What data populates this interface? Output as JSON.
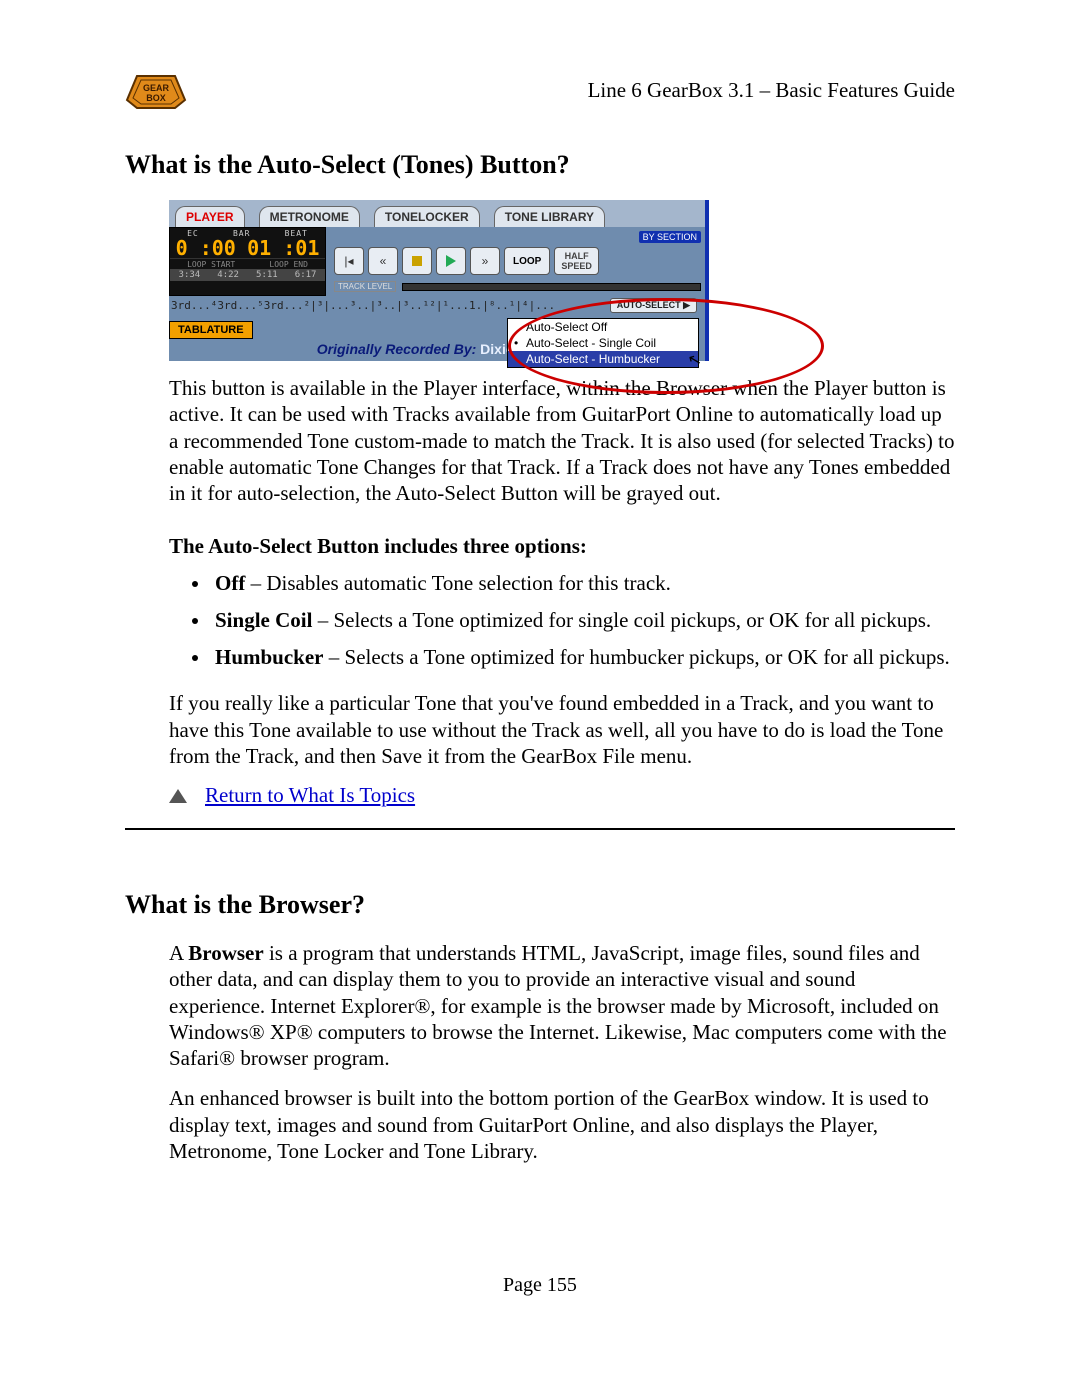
{
  "header": {
    "doc_title": "Line 6 GearBox 3.1 – Basic Features Guide"
  },
  "section1": {
    "heading": "What is the Auto-Select (Tones) Button?",
    "para1": "This button is available in the Player interface, within the Browser when the Player button is active. It can be used with Tracks available from GuitarPort Online to automatically load up a recommended Tone custom-made to match the Track. It is also used (for selected Tracks) to enable automatic Tone Changes for that Track. If a Track does not have any Tones embedded in it for auto-selection, the Auto-Select Button will be grayed out.",
    "subhead": "The Auto-Select Button includes three options:",
    "options": [
      {
        "bold": "Off",
        "text": " – Disables automatic Tone selection for this track."
      },
      {
        "bold": "Single Coil",
        "text": " – Selects a Tone optimized for single coil pickups, or OK for all pickups."
      },
      {
        "bold": "Humbucker",
        "text": " – Selects a Tone optimized for humbucker pickups, or OK for all pickups."
      }
    ],
    "para2": "If you really like a particular Tone that you've found embedded in a Track, and you want to have this Tone available to use without the Track as well, all you have to do is load the Tone from the Track, and then Save it from the GearBox File menu.",
    "return_label": "Return to What Is Topics"
  },
  "section2": {
    "heading": "What is the Browser?",
    "para1_pre": "A ",
    "para1_bold": "Browser",
    "para1_post": " is a program that understands HTML, JavaScript, image files, sound files and other data, and can display them to you to provide an interactive visual and sound experience. Internet Explorer®, for example is the browser made by Microsoft, included on Windows® XP® computers to browse the Internet. Likewise, Mac computers come with the Safari® browser program.",
    "para2": "An enhanced browser is built into the bottom portion of the GearBox window. It is used to display text, images and sound from GuitarPort Online, and also displays the Player, Metronome, Tone Locker and Tone Library."
  },
  "shot": {
    "tabs": [
      "PLAYER",
      "METRONOME",
      "TONELOCKER",
      "TONE LIBRARY"
    ],
    "lcd": {
      "top_labels": [
        "EC",
        "BAR",
        "BEAT"
      ],
      "time": "0 :00",
      "barbeat": "01 :01",
      "sub_labels": [
        "LOOP START",
        "LOOP END"
      ],
      "foot": [
        "3:34",
        "4:22",
        "5:11",
        "6:17"
      ]
    },
    "by_section": "BY SECTION",
    "loop": "LOOP",
    "half_speed": [
      "HALF",
      "SPEED"
    ],
    "track_level": "TRACK LEVEL",
    "scale_text": "3rd...⁴3rd...⁵3rd...²|³|...³..|³..|³..¹²|¹...1.|⁸..¹|⁴|...",
    "auto_select": "AUTO-SELECT ▶",
    "popup": [
      "Auto-Select Off",
      "Auto-Select - Single Coil",
      "Auto-Select - Humbucker"
    ],
    "tablature": "TABLATURE",
    "orig_label": "Originally Recorded By: ",
    "orig_artist": "Dixie Dregs"
  },
  "footer": "Page 155"
}
